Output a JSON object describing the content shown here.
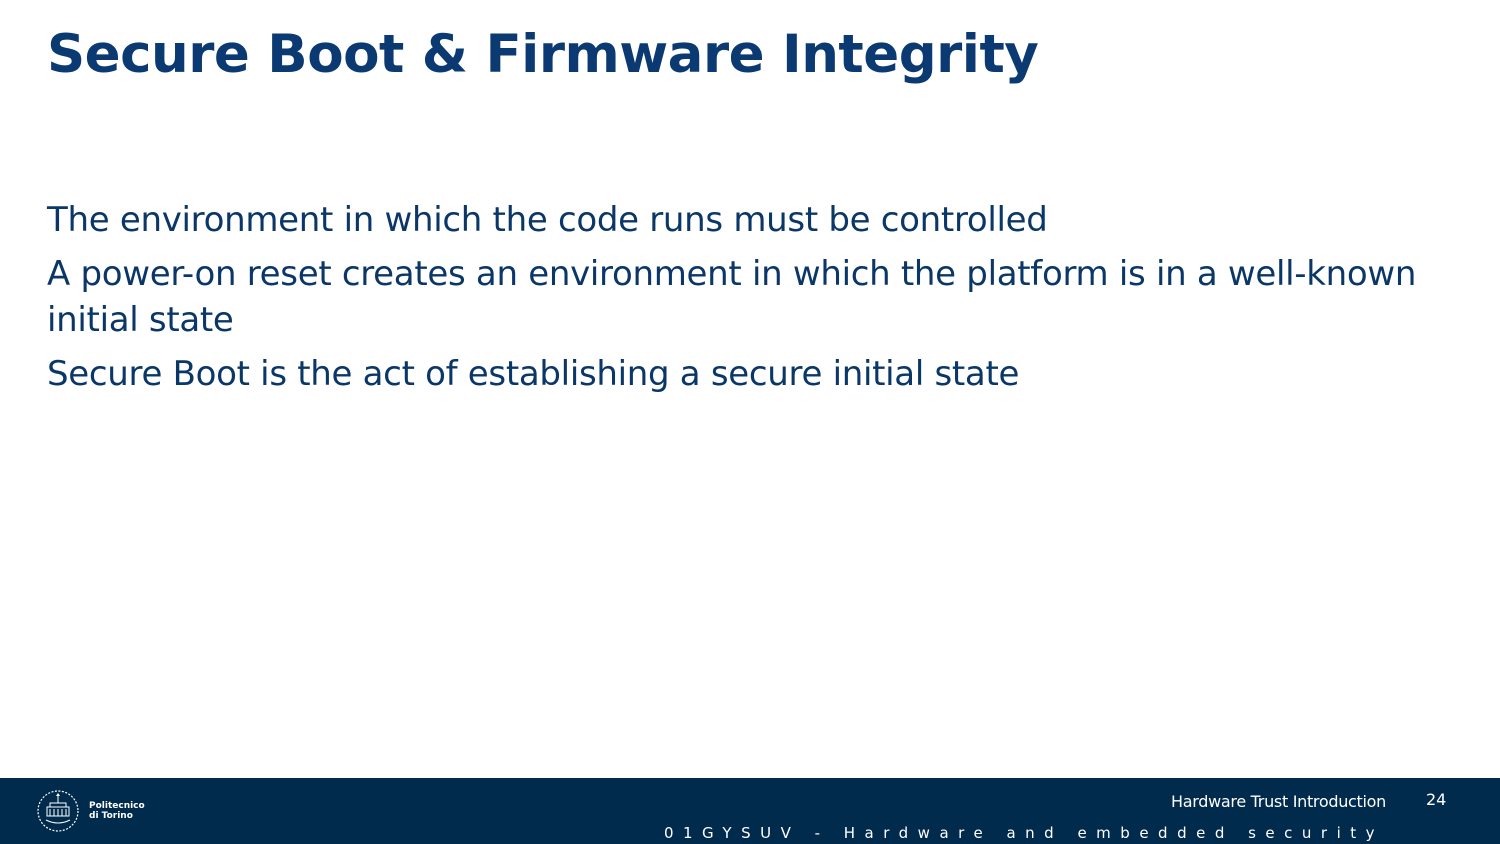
{
  "slide": {
    "title": "Secure Boot & Firmware Integrity",
    "bullets": [
      "The environment in which the code runs must be controlled",
      "A power-on reset creates an environment in which the platform is in a well-known initial state",
      "Secure Boot is the act of establishing a secure initial state"
    ]
  },
  "footer": {
    "logo_line1": "Politecnico",
    "logo_line2": "di Torino",
    "topic": "Hardware Trust Introduction",
    "page_number": "24",
    "course": "01GYSUV - Hardware and embedded security"
  },
  "colors": {
    "title": "#0b3a73",
    "body_text": "#0b3768",
    "footer_background": "#002b4d",
    "footer_text": "#ffffff"
  },
  "icons": {
    "logo": "politecnico-torino-seal-icon"
  }
}
